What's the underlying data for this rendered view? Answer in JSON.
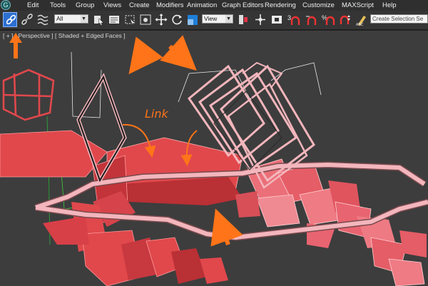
{
  "menu": {
    "logo": "G",
    "items": [
      "Edit",
      "Tools",
      "Group",
      "Views",
      "Create",
      "Modifiers",
      "Animation",
      "Graph Editors",
      "Rendering",
      "Customize",
      "MAXScript",
      "Help"
    ]
  },
  "toolbar": {
    "filter_value": "All",
    "coord_value": "View",
    "selection_set_placeholder": "Create Selection Se"
  },
  "viewport": {
    "label": "[ + ] [ Perspective ] [ Shaded + Edged Faces ]",
    "annotation_text": "Link"
  },
  "colors": {
    "menubar": "#2f2f2f",
    "toolbar": "#353535",
    "viewport_bg": "#3d3d3d",
    "selected_red": "#e0484c",
    "wire_pink": "#f3b6bc",
    "annotation_orange": "#ff7418",
    "active_button": "#2d6fd0"
  },
  "icons": [
    "select-and-link-icon",
    "unlink-icon",
    "bind-space-warp-icon",
    "select-object-icon",
    "select-by-name-icon",
    "rectangle-region-icon",
    "window-crossing-icon",
    "move-icon",
    "rotate-icon",
    "scale-icon",
    "pivot-icon",
    "mirror-icon",
    "align-icon",
    "snap-3d-icon",
    "angle-snap-icon",
    "percent-snap-icon",
    "spinner-snap-icon",
    "edit-named-sets-icon"
  ]
}
